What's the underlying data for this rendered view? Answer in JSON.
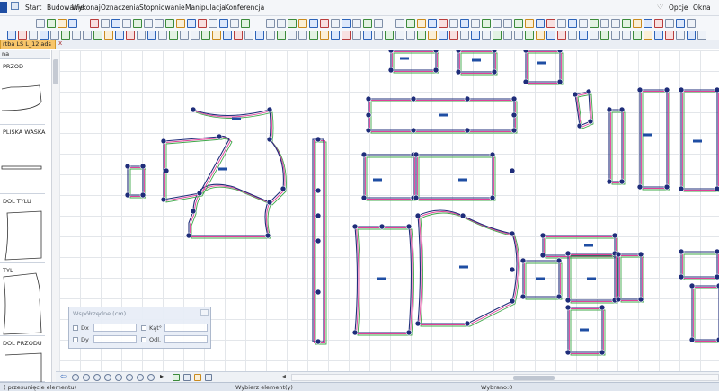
{
  "menu": {
    "app_button": "",
    "items": [
      "Start",
      "Budowanie",
      "Wykonaj",
      "Oznaczenia",
      "Stopniowanie",
      "Manipulacja",
      "Konferencja"
    ],
    "right": {
      "options": "Opcje",
      "window": "Okna"
    }
  },
  "tab": {
    "title": "rtba LS L_12.ads",
    "close": "x"
  },
  "sidebar": {
    "header": "na",
    "pieces": [
      "PRZOD",
      "PLISKA WASKA",
      "DOL TYLU",
      "TYL",
      "DOL PRZODU"
    ]
  },
  "coord_panel": {
    "title": "Współrzędne (cm)",
    "dx_label": "Dx",
    "dy_label": "Dy",
    "angle_label": "Kąt°",
    "dist_label": "Odl."
  },
  "status": {
    "left": "( przesunięcie elementu)",
    "mid": "Wybierz element(y)",
    "right": "Wybrano:0"
  },
  "colors": {
    "accent": "#1f4ea3",
    "node": "#1f2d7a",
    "pink": "#e0409a",
    "green": "#3fa84a",
    "tab": "#f7c56a"
  }
}
